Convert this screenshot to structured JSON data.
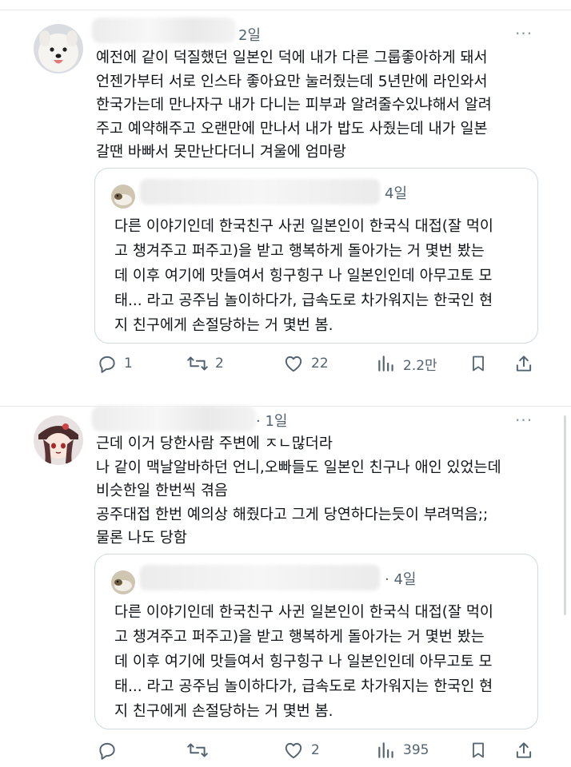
{
  "tweet1": {
    "time": "2일",
    "more": "···",
    "text": "예전에 같이 덕질했던 일본인 덕에 내가 다른 그룹좋아하게 돼서\n언젠가부터 서로 인스타 좋아요만 눌러줬는데 5년만에 라인와서\n한국가는데 만나자구 내가 다니는 피부과 알려줄수있냐해서 알려\n주고 예약해주고 오랜만에 만나서 내가 밥도 사줬는데 내가 일본\n갈땐 바빠서 못만난다더니 겨울에 엄마랑",
    "quote": {
      "time": "4일",
      "text": "다른 이야기인데 한국친구 사귄 일본인이 한국식 대접(잘 먹이\n고 챙겨주고 퍼주고)을 받고 행복하게 돌아가는 거 몇번 봤는\n데 이후 여기에 맛들여서 힝구힝구 나 일본인인데 아무고토 모\n태... 라고 공주님 놀이하다가, 급속도로 차가워지는 한국인 현\n지 친구에게 손절당하는 거 몇번 봄."
    },
    "actions": {
      "replies": "1",
      "reposts": "2",
      "likes": "22",
      "views": "2.2만"
    }
  },
  "tweet2": {
    "time": "· 1일",
    "more": "···",
    "text": "근데 이거 당한사람 주변에 ㅈㄴ많더라\n나 같이 맥날알바하던 언니,오빠들도 일본인 친구나 애인 있었는데\n비슷한일 한번씩 겪음\n공주대접 한번 예의상 해줬다고 그게 당연하다는듯이 부려먹음;;\n물론 나도 당함",
    "quote": {
      "time": "· 4일",
      "text": "다른 이야기인데 한국친구 사귄 일본인이 한국식 대접(잘 먹이\n고 챙겨주고 퍼주고)을 받고 행복하게 돌아가는 거 몇번 봤는\n데 이후 여기에 맛들여서 힝구힝구 나 일본인인데 아무고토 모\n태... 라고 공주님 놀이하다가, 급속도로 차가워지는 한국인 현\n지 친구에게 손절당하는 거 몇번 봄."
    },
    "actions": {
      "replies": "",
      "reposts": "",
      "likes": "2",
      "views": "395"
    }
  },
  "icons": [
    "reply-icon",
    "repost-icon",
    "like-icon",
    "views-icon",
    "bookmark-icon",
    "share-icon"
  ],
  "colors": {
    "text": "#0f1419",
    "muted": "#536471",
    "border": "#cfd9de"
  }
}
